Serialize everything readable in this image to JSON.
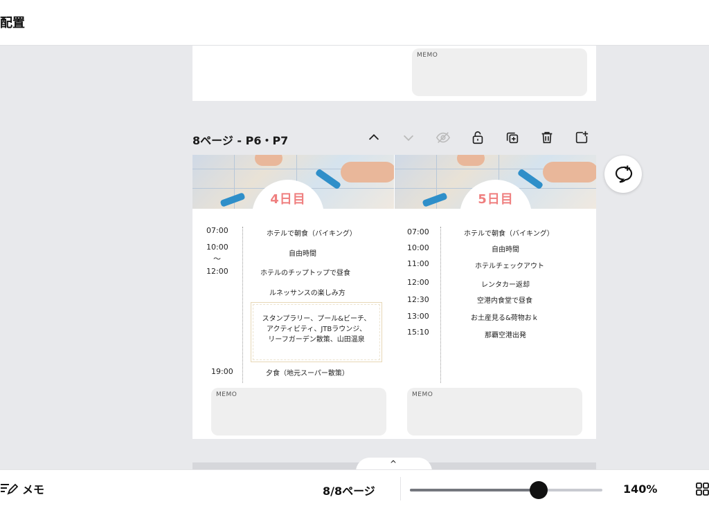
{
  "header": {
    "title": "配置"
  },
  "prev_page": {
    "memo_label": "MEMO"
  },
  "page_header": {
    "label": "8ページ - P6・P7",
    "tools": [
      "chevron-up-icon",
      "chevron-down-icon",
      "eye-off-icon",
      "unlock-icon",
      "duplicate-icon",
      "trash-icon",
      "add-page-icon"
    ]
  },
  "page": {
    "day4": {
      "badge": "4日目",
      "times": [
        "07:00",
        "10:00",
        "～",
        "12:00",
        "19:00"
      ],
      "items": [
        "ホテルで朝食（バイキング）",
        "自由時間",
        "ホテルのチップトップで昼食",
        "ルネッサンスの楽しみ方",
        "夕食（地元スーパー散策）"
      ],
      "box_lines": [
        "スタンプラリー、プール&ビーチ、",
        "アクティビティ、JTBラウンジ、",
        "リーフガーデン散策、山田温泉"
      ],
      "memo_label": "MEMO"
    },
    "day5": {
      "badge": "5日目",
      "times": [
        "07:00",
        "10:00",
        "11:00",
        "12:00",
        "12:30",
        "13:00",
        "15:10"
      ],
      "items": [
        "ホテルで朝食（バイキング）",
        "自由時間",
        "ホテルチェックアウト",
        "レンタカー返却",
        "空港内食堂で昼食",
        "お土産見る&荷物おｋ",
        "那覇空港出発"
      ],
      "memo_label": "MEMO"
    }
  },
  "bottom_bar": {
    "notes_label": "メモ",
    "page_count": "8/8ページ",
    "zoom_label": "140%",
    "zoom_fraction": 0.67
  },
  "colors": {
    "accent_badge": "#ef7f7f",
    "page_bg": "#ffffff",
    "workspace_bg": "#e8e9ec"
  }
}
